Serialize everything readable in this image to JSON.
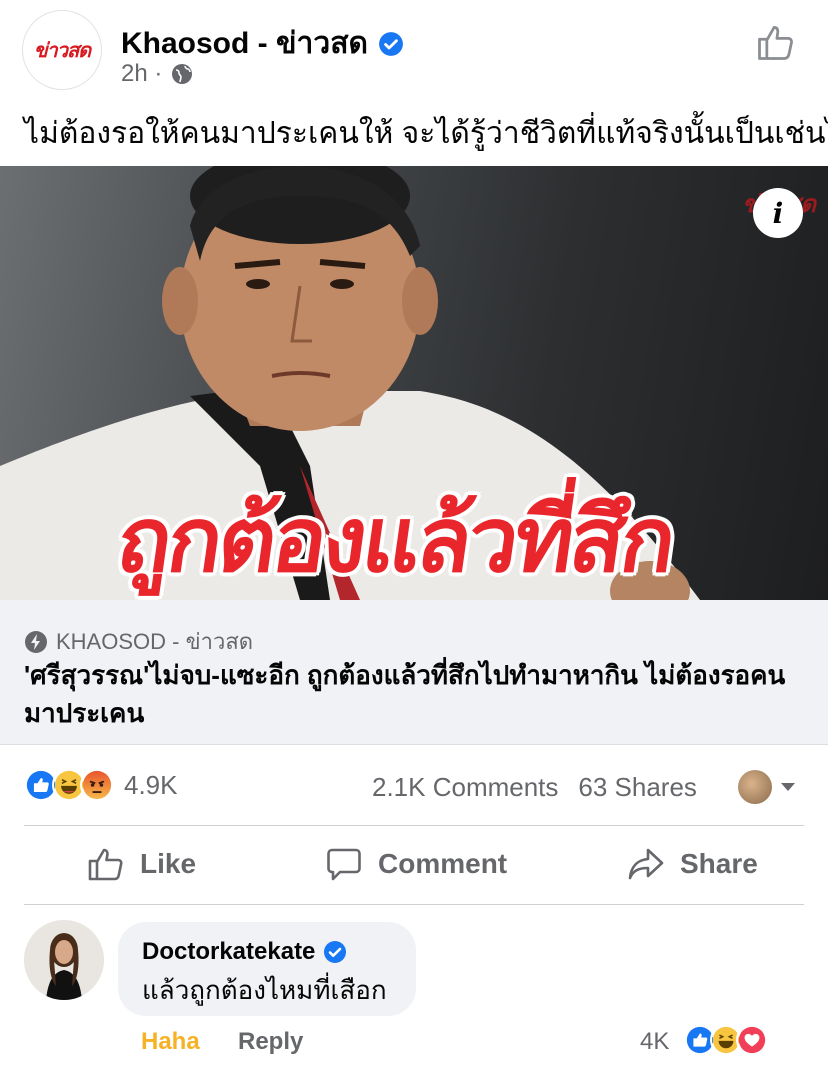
{
  "post": {
    "page_name": "Khaosod - ข่าวสด",
    "page_logo_text": "ข่าวสด",
    "time": "2h ·",
    "text": "ไม่ต้องรอให้คนมาประเคนให้ จะได้รู้ว่าชีวิตที่แท้จริงนั้นเป็นเช่นไร"
  },
  "media": {
    "headline": "ถูกต้องแล้วที่สึก",
    "watermark": "ข่าวสด",
    "info_label": "i"
  },
  "link": {
    "source": "KHAOSOD - ข่าวสด",
    "title": "'ศรีสุวรรณ'ไม่จบ-แซะอีก ถูกต้องแล้วที่สึกไปทำมาหากิน ไม่ต้องรอคนมาประเคน"
  },
  "stats": {
    "reaction_count": "4.9K",
    "comments": "2.1K Comments",
    "shares": "63 Shares"
  },
  "actions": {
    "like": "Like",
    "comment": "Comment",
    "share": "Share"
  },
  "comment": {
    "author": "Doctorkatekate",
    "text": "แล้วถูกต้องไหมที่เสือก",
    "haha": "Haha",
    "reply": "Reply",
    "reaction_count": "4K"
  },
  "colors": {
    "facebook_blue": "#1877f2",
    "haha_label": "#f7b125",
    "secondary_text": "#65676b",
    "headline_red": "#e8262c"
  }
}
